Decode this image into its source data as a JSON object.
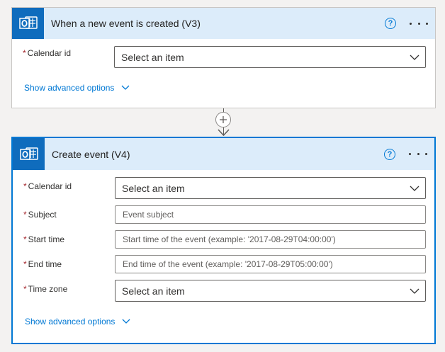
{
  "trigger": {
    "title": "When a new event is created (V3)",
    "icon": "outlook-icon",
    "help_glyph": "?",
    "fields": {
      "calendar_id": {
        "label": "Calendar id",
        "required": "*",
        "value": "Select an item"
      }
    },
    "advanced_label": "Show advanced options"
  },
  "connector": {
    "icon": "plus-icon"
  },
  "action": {
    "title": "Create event (V4)",
    "icon": "outlook-icon",
    "help_glyph": "?",
    "fields": {
      "calendar_id": {
        "label": "Calendar id",
        "required": "*",
        "value": "Select an item"
      },
      "subject": {
        "label": "Subject",
        "required": "*",
        "placeholder": "Event subject"
      },
      "start_time": {
        "label": "Start time",
        "required": "*",
        "placeholder": "Start time of the event (example: '2017-08-29T04:00:00')"
      },
      "end_time": {
        "label": "End time",
        "required": "*",
        "placeholder": "End time of the event (example: '2017-08-29T05:00:00')"
      },
      "time_zone": {
        "label": "Time zone",
        "required": "*",
        "value": "Select an item"
      }
    },
    "advanced_label": "Show advanced options"
  },
  "colors": {
    "accent": "#0078d4",
    "header_bg": "#dcecfa",
    "outlook_tile": "#0f6cbd",
    "required": "#a4262c"
  }
}
